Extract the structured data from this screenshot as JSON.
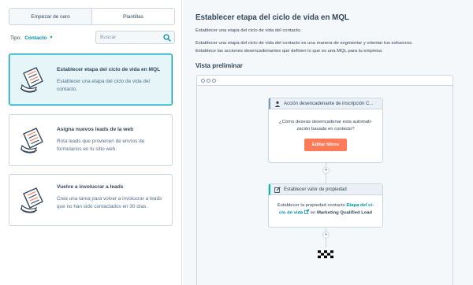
{
  "left_panel": {
    "tabs": [
      {
        "label": "Empezar de cero",
        "active": false
      },
      {
        "label": "Plantillas",
        "active": true
      }
    ],
    "filter": {
      "label": "Tipo:",
      "value": "Contacto"
    },
    "search": {
      "placeholder": "Buscar"
    },
    "templates": [
      {
        "title": "Establecer etapa del ciclo de vida en MQL",
        "description": "Establecer una etapa del ciclo de vida del contacto.",
        "selected": true
      },
      {
        "title": "Asigna nuevos leads de la web",
        "description": "Rota leads que provienen de envíos de formularios en tu sitio web.",
        "selected": false
      },
      {
        "title": "Vuelve a involucrar a leads",
        "description": "Crea una tarea para volver a involucrar a leads que no han sido contactados en 30 días.",
        "selected": false
      }
    ]
  },
  "detail": {
    "title": "Establecer etapa del ciclo de vida en MQL",
    "summary": "Establecer una etapa del ciclo de vida del contacto.",
    "description_line1": "Establecer una etapa del ciclo de vida del contacto es una manera de segmentar y orientar tus esfuerzos.",
    "description_line2": "Establece las acciones desencadenantes que definen lo que es una MQL para tu empresa",
    "preview_title": "Vista preliminar"
  },
  "workflow": {
    "trigger": {
      "header": "Acción desencadenante de inscripción C...",
      "question_line1": "¿Cómo deseas desencadenar esta automati-",
      "question_line2": "zación basada en contacto?",
      "button": "Editar filtros"
    },
    "action": {
      "header": "Establecer valor de propiedad",
      "text_pre": "Establecer la propiedad contacto",
      "link_line1": "Etapa del ci-",
      "link_line2": "clo de vida",
      "text_mid": "en",
      "value": "Marketing Qualified Lead"
    }
  },
  "colors": {
    "accent": "#00a4bd",
    "link": "#0091ae",
    "button": "#ff7a59",
    "text": "#33475b",
    "panel_bg": "#f5f8fa"
  },
  "icons": [
    "search-icon",
    "template-document-icon",
    "person-icon",
    "edit-icon",
    "external-link-icon",
    "plus-icon",
    "finish-flag-icon"
  ]
}
